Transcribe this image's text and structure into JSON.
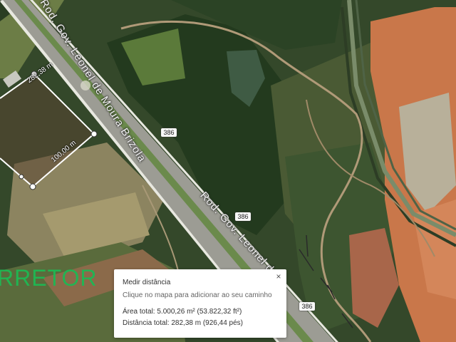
{
  "map": {
    "road_name_upper": "Rod. Gov. Leonel de Moura Brizola",
    "road_name_lower": "Rod. Gov. Leonel de",
    "route_shields": [
      "386",
      "386",
      "386"
    ],
    "colors": {
      "vegetation_dark": "#263a1f",
      "vegetation_mid": "#4d6232",
      "field_light": "#8d8459",
      "soil_red": "#d07a4c",
      "road": "#9a9a92",
      "measure_line": "#ffffff"
    }
  },
  "measurement": {
    "segment_labels": [
      "282,38 m",
      "100,00 m"
    ]
  },
  "watermark": {
    "text": "RRETOR",
    "color": "#1db954"
  },
  "panel": {
    "title": "Medir distância",
    "hint": "Clique no mapa para adicionar ao seu caminho",
    "area_total": "Área total: 5.000,26 m² (53.822,32 ft²)",
    "distance_total": "Distância total: 282,38 m (926,44 pés)",
    "close_icon": "×"
  }
}
